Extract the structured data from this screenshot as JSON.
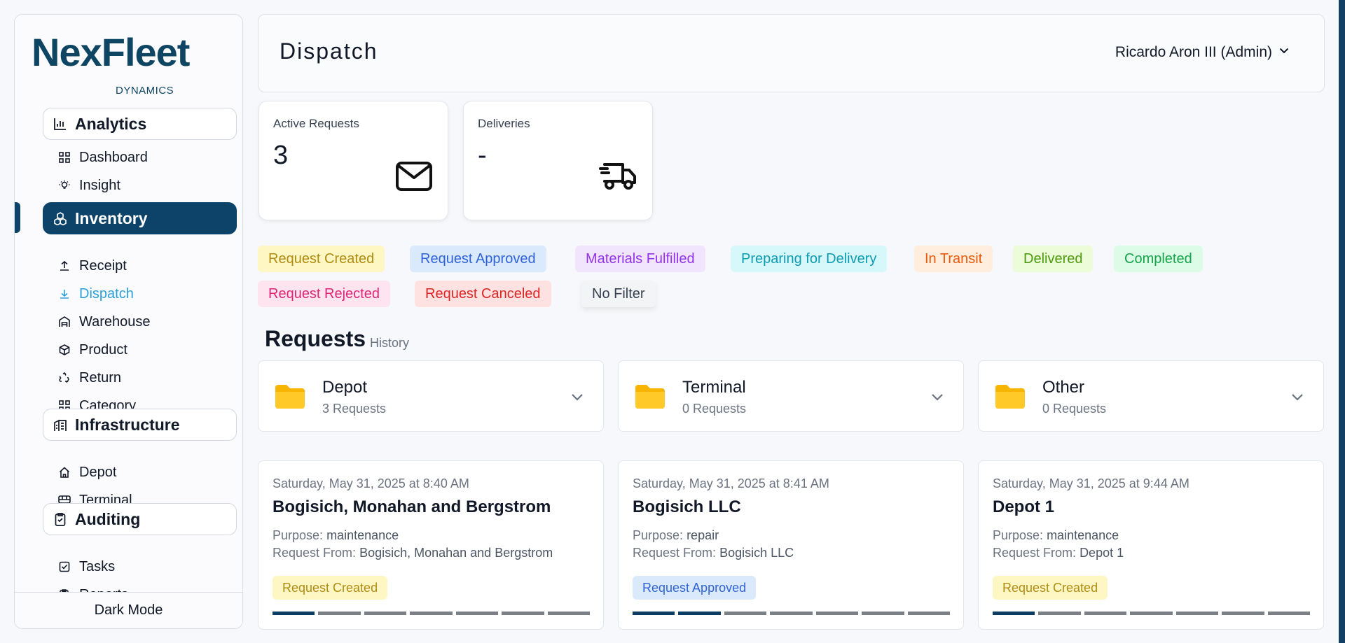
{
  "brand": {
    "name": "NexFleet",
    "sub": "DYNAMICS"
  },
  "sidebar": {
    "groups": [
      {
        "label": "Analytics",
        "icon": "chart-icon",
        "items": [
          {
            "label": "Dashboard",
            "icon": "grid-icon"
          },
          {
            "label": "Insight",
            "icon": "lightbulb-icon"
          }
        ]
      },
      {
        "label": "Inventory",
        "icon": "boxes-icon",
        "active": true,
        "items": [
          {
            "label": "Receipt",
            "icon": "upload-icon"
          },
          {
            "label": "Dispatch",
            "icon": "download-icon",
            "active": true
          },
          {
            "label": "Warehouse",
            "icon": "warehouse-icon"
          },
          {
            "label": "Product",
            "icon": "box-icon"
          },
          {
            "label": "Return",
            "icon": "recycle-icon"
          },
          {
            "label": "Category",
            "icon": "grid-icon"
          }
        ]
      },
      {
        "label": "Infrastructure",
        "icon": "building-icon",
        "items": [
          {
            "label": "Depot",
            "icon": "home-icon"
          },
          {
            "label": "Terminal",
            "icon": "bus-icon"
          }
        ]
      },
      {
        "label": "Auditing",
        "icon": "clipboard-check-icon",
        "items": [
          {
            "label": "Tasks",
            "icon": "checkbox-icon"
          },
          {
            "label": "Reports",
            "icon": "report-icon"
          }
        ]
      }
    ],
    "footer": "Dark Mode"
  },
  "header": {
    "title": "Dispatch",
    "user": "Ricardo Aron III (Admin)"
  },
  "stats": [
    {
      "label": "Active Requests",
      "value": "3",
      "icon": "mail-icon"
    },
    {
      "label": "Deliveries",
      "value": "-",
      "icon": "truck-icon"
    }
  ],
  "filters": [
    {
      "label": "Request Created",
      "bg": "#fef6c3",
      "fg": "#b08c12"
    },
    {
      "label": "Request Approved",
      "bg": "#dbe9fd",
      "fg": "#2f63d6"
    },
    {
      "label": "Materials Fulfilled",
      "bg": "#f1e5fd",
      "fg": "#9333ea"
    },
    {
      "label": "Preparing for Delivery",
      "bg": "#d7f8fb",
      "fg": "#0e9cb3"
    },
    {
      "label": "In Transit",
      "bg": "#ffeddd",
      "fg": "#ea580c"
    },
    {
      "label": "Delivered",
      "bg": "#ecfbd8",
      "fg": "#4d9a0f"
    },
    {
      "label": "Completed",
      "bg": "#dcfce7",
      "fg": "#16a34a"
    },
    {
      "label": "Request Rejected",
      "bg": "#fde4ee",
      "fg": "#db2777"
    },
    {
      "label": "Request Canceled",
      "bg": "#fee2e2",
      "fg": "#dc2626"
    },
    {
      "label": "No Filter",
      "bg": "#f3f4f6",
      "fg": "#374151"
    }
  ],
  "requests_section": {
    "title": "Requests",
    "subtitle": "History"
  },
  "folders": [
    {
      "name": "Depot",
      "count": "3 Requests"
    },
    {
      "name": "Terminal",
      "count": "0 Requests"
    },
    {
      "name": "Other",
      "count": "0 Requests"
    }
  ],
  "labels": {
    "purpose": "Purpose:",
    "from": "Request From:"
  },
  "requests": [
    {
      "date": "Saturday, May 31, 2025 at 8:40 AM",
      "name": "Bogisich, Monahan and Bergstrom",
      "purpose": "maintenance",
      "from": "Bogisich, Monahan and Bergstrom",
      "status": "Request Created",
      "status_bg": "#fef6c3",
      "status_fg": "#b08c12",
      "progress_step": 1,
      "progress_total": 7
    },
    {
      "date": "Saturday, May 31, 2025 at 8:41 AM",
      "name": "Bogisich LLC",
      "purpose": "repair",
      "from": "Bogisich LLC",
      "status": "Request Approved",
      "status_bg": "#dbe9fd",
      "status_fg": "#2f63d6",
      "progress_step": 2,
      "progress_total": 7
    },
    {
      "date": "Saturday, May 31, 2025 at 9:44 AM",
      "name": "Depot 1",
      "purpose": "maintenance",
      "from": "Depot 1",
      "status": "Request Created",
      "status_bg": "#fef6c3",
      "status_fg": "#b08c12",
      "progress_step": 1,
      "progress_total": 7
    }
  ]
}
